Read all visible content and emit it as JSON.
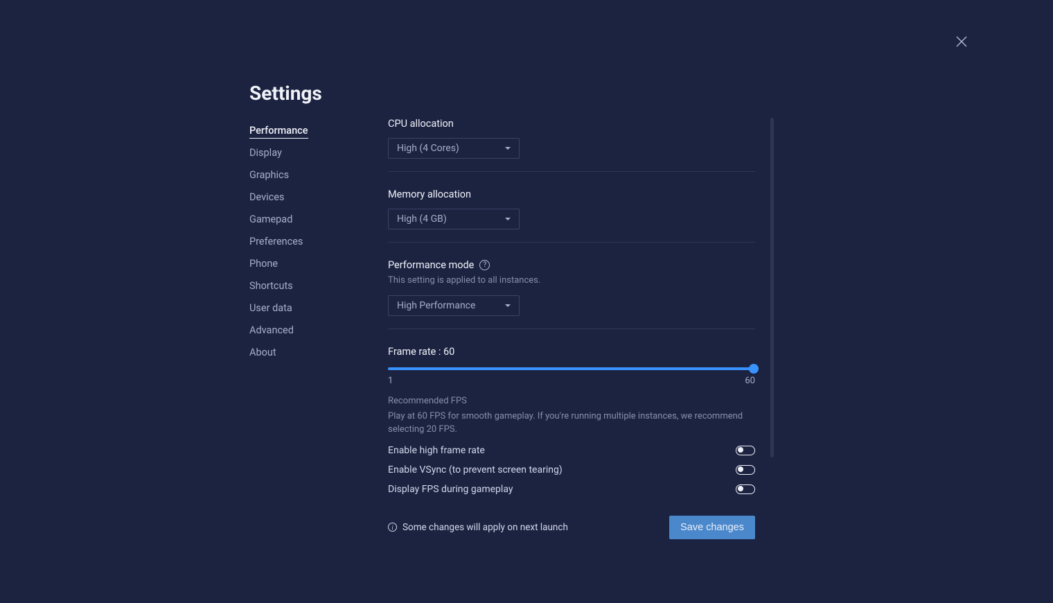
{
  "page_title": "Settings",
  "sidebar": {
    "items": [
      "Performance",
      "Display",
      "Graphics",
      "Devices",
      "Gamepad",
      "Preferences",
      "Phone",
      "Shortcuts",
      "User data",
      "Advanced",
      "About"
    ],
    "active_index": 0
  },
  "cpu": {
    "label": "CPU allocation",
    "selected": "High (4 Cores)"
  },
  "memory": {
    "label": "Memory allocation",
    "selected": "High (4 GB)"
  },
  "performance_mode": {
    "label": "Performance mode",
    "sublabel": "This setting is applied to all instances.",
    "selected": "High Performance"
  },
  "frame_rate": {
    "label": "Frame rate : 60",
    "min": "1",
    "max": "60",
    "hint_title": "Recommended FPS",
    "hint_text": "Play at 60 FPS for smooth gameplay. If you're running multiple instances, we recommend selecting 20 FPS."
  },
  "toggles": {
    "high_frame": "Enable high frame rate",
    "vsync": "Enable VSync (to prevent screen tearing)",
    "display_fps": "Display FPS during gameplay"
  },
  "footer": {
    "note": "Some changes will apply on next launch",
    "save": "Save changes"
  }
}
